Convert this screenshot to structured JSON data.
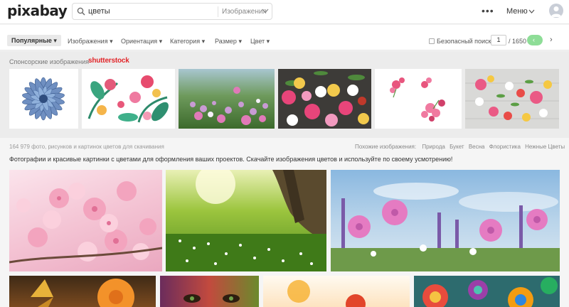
{
  "header": {
    "logo": "pixabay",
    "search": {
      "value": "цветы",
      "type": "Изображения"
    },
    "more": "•••",
    "menu": "Меню"
  },
  "filters": {
    "popular": "Популярные",
    "items": [
      "Изображения",
      "Ориентация",
      "Категория",
      "Размер",
      "Цвет"
    ],
    "safe_search": "Безопасный поиск",
    "page": "1",
    "total": "/ 1650",
    "prev": "‹",
    "next": "›"
  },
  "sponsored": {
    "label": "Спонсорские изображения",
    "brand": "shutterstock"
  },
  "info": {
    "count": "164 979 фото, рисунков и картинок цветов для скачивания",
    "related_label": "Похожие изображения:",
    "related": [
      "Природа",
      "Букет",
      "Весна",
      "Флористика",
      "Нежные Цветы"
    ],
    "description": "Фотографии и красивые картинки с цветами для оформления ваших проектов. Скачайте изображения цветов и используйте по своему усмотрению!"
  },
  "colors": {
    "accent": "#8edd97",
    "brand_red": "#e2262a"
  }
}
